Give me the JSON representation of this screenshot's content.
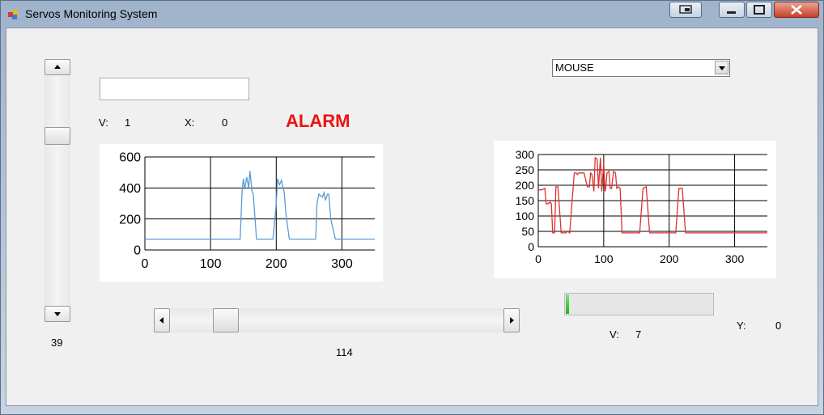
{
  "window": {
    "title": "Servos Monitoring System"
  },
  "left_scroll": {
    "value_label": "39"
  },
  "left_panel": {
    "v_label": "V:",
    "v_value": "1",
    "x_label": "X:",
    "x_value": "0",
    "alarm": "ALARM"
  },
  "right_panel": {
    "combo_value": "MOUSE",
    "v_label": "V:",
    "v_value": "7",
    "y_label": "Y:",
    "y_value": "0",
    "progress_fraction": 0.02
  },
  "bottom_scroll": {
    "value_label": "114"
  },
  "colors": {
    "left_series": "#5b9bd5",
    "right_series": "#e03030",
    "alarm": "#ee1111"
  },
  "chart_data": [
    {
      "type": "line",
      "xlim": [
        0,
        350
      ],
      "ylim": [
        0,
        600
      ],
      "xticks": [
        0,
        100,
        200,
        300
      ],
      "yticks": [
        0,
        200,
        400,
        600
      ],
      "grid": true,
      "series": [
        {
          "x": [
            0,
            140,
            145,
            148,
            150,
            152,
            155,
            158,
            160,
            163,
            165,
            170,
            175,
            185,
            195,
            200,
            202,
            205,
            208,
            210,
            212,
            215,
            220,
            225,
            240,
            255,
            260,
            262,
            265,
            270,
            273,
            275,
            278,
            280,
            283,
            290,
            300,
            350
          ],
          "y": [
            70,
            70,
            70,
            380,
            460,
            390,
            470,
            400,
            510,
            380,
            360,
            70,
            70,
            70,
            70,
            300,
            460,
            420,
            450,
            400,
            380,
            220,
            70,
            70,
            70,
            70,
            70,
            300,
            360,
            340,
            370,
            320,
            360,
            360,
            200,
            70,
            70,
            70
          ]
        }
      ]
    },
    {
      "type": "line",
      "xlim": [
        0,
        350
      ],
      "ylim": [
        0,
        300
      ],
      "xticks": [
        0,
        100,
        200,
        300
      ],
      "yticks": [
        0,
        50,
        100,
        150,
        200,
        250,
        300
      ],
      "grid": true,
      "series": [
        {
          "x": [
            0,
            5,
            10,
            12,
            15,
            18,
            20,
            22,
            25,
            27,
            30,
            35,
            40,
            42,
            45,
            48,
            55,
            58,
            60,
            62,
            70,
            75,
            78,
            80,
            82,
            85,
            87,
            90,
            92,
            95,
            97,
            100,
            102,
            103,
            105,
            108,
            110,
            112,
            115,
            118,
            120,
            122,
            125,
            128,
            130,
            132,
            135,
            155,
            160,
            165,
            170,
            175,
            180,
            200,
            210,
            215,
            220,
            225,
            230,
            350
          ],
          "y": [
            185,
            185,
            190,
            140,
            140,
            145,
            140,
            45,
            45,
            195,
            195,
            45,
            45,
            45,
            50,
            45,
            240,
            240,
            235,
            240,
            240,
            195,
            195,
            240,
            235,
            180,
            290,
            285,
            190,
            290,
            180,
            270,
            180,
            190,
            240,
            245,
            190,
            190,
            245,
            240,
            190,
            195,
            190,
            45,
            45,
            45,
            45,
            45,
            190,
            195,
            45,
            45,
            45,
            45,
            45,
            190,
            190,
            45,
            45,
            45
          ]
        }
      ]
    }
  ]
}
